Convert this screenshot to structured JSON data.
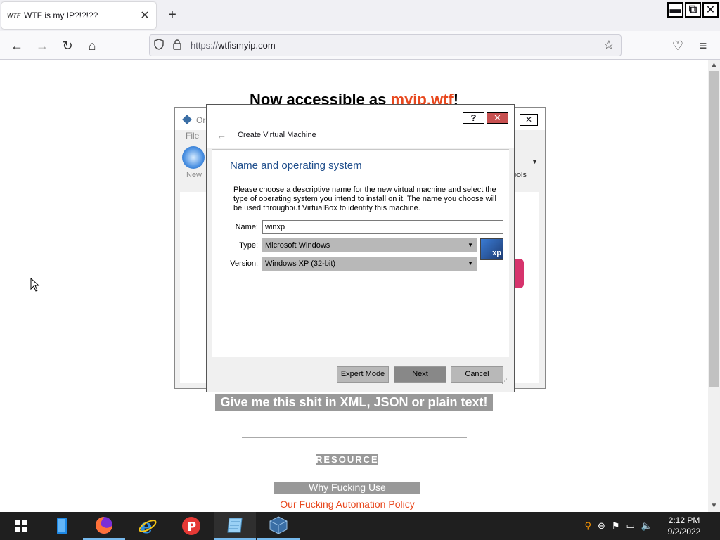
{
  "browser": {
    "tab": {
      "favicon_text": "WTF",
      "title": "WTF is my IP?!?!??",
      "close_glyph": "✕"
    },
    "new_tab_glyph": "+",
    "url": {
      "protocol": "https://",
      "domain": "wtfismyip.com"
    },
    "window_controls": {
      "minimize": "▬",
      "restore": "⧉",
      "close": "✕"
    },
    "nav": {
      "back": "←",
      "forward": "→",
      "reload": "↻",
      "home": "⌂",
      "star": "☆",
      "pocket": "♡",
      "menu": "≡"
    }
  },
  "page": {
    "headline_prefix": "Now accessible as ",
    "headline_accent": "myip.wtf",
    "headline_suffix": "!",
    "plain_text_link": "Give me this shit in XML, JSON or plain text!",
    "resources_heading": "RESOURCES",
    "why_link": "Why Fucking Use wtfismyip.com?",
    "policy_link": "Our Fucking Automation Policy"
  },
  "vbox_manager": {
    "title": "Ora",
    "menu_file": "File",
    "new_label": "New",
    "tools_label": "ools"
  },
  "dialog": {
    "window_title": "Create Virtual Machine",
    "help_glyph": "?",
    "close_glyph": "✕",
    "back_glyph": "←",
    "heading": "Name and operating system",
    "description": "Please choose a descriptive name for the new virtual machine and select the type of operating system you intend to install on it. The name you choose will be used throughout VirtualBox to identify this machine.",
    "name_label": "Name:",
    "name_value": "winxp",
    "type_label": "Type:",
    "type_value": "Microsoft Windows",
    "version_label": "Version:",
    "version_value": "Windows XP (32-bit)",
    "os_icon_text": "xp",
    "buttons": {
      "expert": "Expert Mode",
      "next": "Next",
      "cancel": "Cancel"
    }
  },
  "taskbar": {
    "clock_time": "2:12 PM",
    "clock_date": "9/2/2022",
    "apps": [
      "windows-start",
      "phone-app",
      "firefox",
      "internet-explorer",
      "wordpad",
      "notepad",
      "virtualbox"
    ]
  },
  "colors": {
    "accent": "#e8481e",
    "dialog_heading": "#1f4e8c",
    "taskbar": "#1f1f1f"
  }
}
